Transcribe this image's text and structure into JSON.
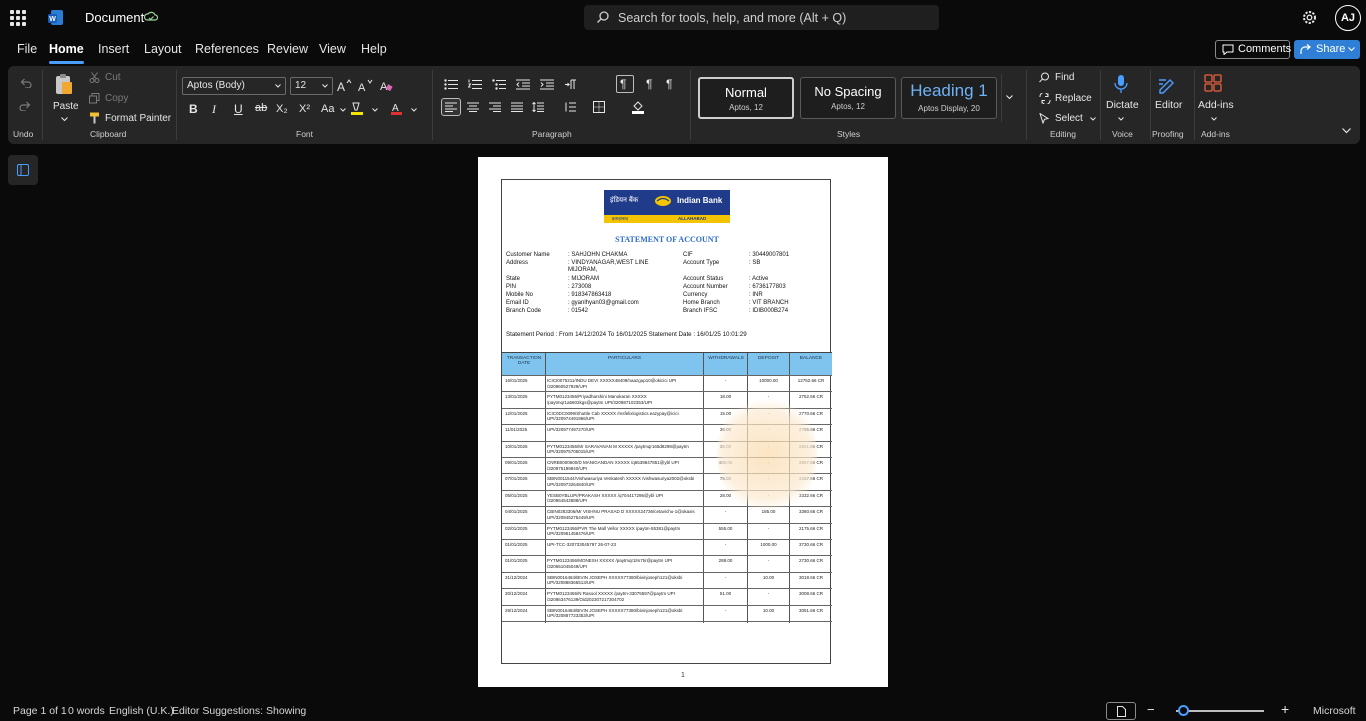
{
  "titlebar": {
    "doc_title": "Document",
    "search_placeholder": "Search for tools, help, and more (Alt + Q)",
    "avatar_initials": "AJ"
  },
  "menu": {
    "tabs": [
      "File",
      "Home",
      "Insert",
      "Layout",
      "References",
      "Review",
      "View",
      "Help"
    ],
    "active": "Home",
    "comments_label": "Comments",
    "share_label": "Share"
  },
  "ribbon": {
    "undo_label": "Undo",
    "clipboard": {
      "paste": "Paste",
      "cut": "Cut",
      "copy": "Copy",
      "format_painter": "Format Painter",
      "label": "Clipboard"
    },
    "font": {
      "family": "Aptos (Body)",
      "size": "12",
      "label": "Font"
    },
    "paragraph": {
      "label": "Paragraph"
    },
    "styles": {
      "items": [
        {
          "name": "Normal",
          "sub": "Aptos, 12"
        },
        {
          "name": "No Spacing",
          "sub": "Aptos, 12"
        },
        {
          "name": "Heading 1",
          "sub": "Aptos Display, 20"
        }
      ],
      "label": "Styles"
    },
    "editing": {
      "find": "Find",
      "replace": "Replace",
      "select": "Select",
      "label": "Editing"
    },
    "voice": {
      "dictate": "Dictate",
      "label": "Voice"
    },
    "proofing": {
      "editor": "Editor",
      "label": "Proofing"
    },
    "addins": {
      "addins": "Add-ins",
      "label": "Add-ins"
    }
  },
  "document": {
    "bank_hindi": "इंडियन बैंक",
    "bank_name": "Indian Bank",
    "bank_tag_hindi": "इलाहाबाद",
    "bank_tag": "ALLAHABAD",
    "title": "STATEMENT OF ACCOUNT",
    "left_fields": [
      {
        "k": "Customer Name",
        "v": ": SAHJOHN CHAKMA"
      },
      {
        "k": "Address",
        "v": ": VINDYANAGAR,WEST LINE"
      },
      {
        "k": "",
        "v": "MIJORAM,"
      },
      {
        "k": "State",
        "v": ": MIJORAM"
      },
      {
        "k": "PIN",
        "v": ": 273008"
      },
      {
        "k": "Mobile No",
        "v": ": 918347863418"
      },
      {
        "k": "Email ID",
        "v": ": gyanlhyan03@gmail.com"
      },
      {
        "k": "Branch Code",
        "v": ": 01542"
      }
    ],
    "right_fields": [
      {
        "k": "CIF",
        "v": ": 30449007801"
      },
      {
        "k": "Account Type",
        "v": ": SB"
      },
      {
        "k": "Account Status",
        "v": ": Active"
      },
      {
        "k": "Account Number",
        "v": ": 6736177803"
      },
      {
        "k": "Currency",
        "v": ": INR"
      },
      {
        "k": "Home Branch",
        "v": ": VIT BRANCH"
      },
      {
        "k": "Branch IFSC",
        "v": ": IDIB000B274"
      }
    ],
    "period": "Statement Period : From 14/12/2024 To 16/01/2025     Statement Date : 16/01/25  10:01:29",
    "headers": [
      "TRANSACTION DATE",
      "PARTICULARS",
      "WITHDRAWALS",
      "DEPOSIT",
      "BALANCE"
    ],
    "rows": [
      {
        "date": "16/01/2025",
        "part": "ICICI0075211/INDU DEVI XXXXX48408/naazgup10@okicici UPI /320960527929/UPI",
        "wd": "-",
        "dep": "10000.00",
        "bal": "12752.66 CR"
      },
      {
        "date": "13/01/2025",
        "part": "PYTM0123456/Priyadharshini Manokaran XXXXX /paytmqr1a5602kgs@paytm UPI/320987102353/UPI",
        "wd": "18.00",
        "dep": "-",
        "bal": "2752.66 CR"
      },
      {
        "date": "12/01/2025",
        "part": "ICIC0DC0099/Shuttle Cab XXXXX /msfelixlogistics.eazypay@icici UPI/320974491966/UPI",
        "wd": "15.00",
        "dep": "-",
        "bal": "2770.66 CR"
      },
      {
        "date": "11/01/2025",
        "part": "UPI/320977497270/UPI",
        "wd": "36.00",
        "dep": "-",
        "bal": "2785.66 CR"
      },
      {
        "date": "10/01/2025",
        "part": "PYTM0123456/Mr SARAVANAN M XXXXX /paytmqr165d8298@paytm UPI/320975705015/UPI",
        "wd": "36.00",
        "dep": "-",
        "bal": "2821.66 CR"
      },
      {
        "date": "09/01/2025",
        "part": "CNRB0000600/D MANIGANDAN XXXXX /q6539847851@ybl UPI /320975199840/UPI",
        "wd": "400.00",
        "dep": "-",
        "bal": "2857.66 CR"
      },
      {
        "date": "07/01/2025",
        "part": "SBIN0011544/Vishwasuriya Venkatesh XXXXX /vishwasuriya2002@oksbi UPI/320973264840/UPI",
        "wd": "75.00",
        "dep": "-",
        "bal": "3257.66 CR"
      },
      {
        "date": "05/01/2025",
        "part": "YESB0YBLUPI/PRAKASH XXXXX /q704417296@ybl UPI /320964542888/UPI",
        "wd": "28.00",
        "dep": "-",
        "bal": "3332.66 CR"
      },
      {
        "date": "04/01/2025",
        "part": "CBIN0283306/Mr VISHNU PRASAD D XXXXX24736/cetavichu-1@okaxis UPI/320845275449/UPI",
        "wd": "-",
        "dep": "185.00",
        "bal": "3360.66 CR"
      },
      {
        "date": "02/01/2025",
        "part": "PYTM0123456/PVR The Mall Vellor XXXXX /paytm-55381@paytm UPI/320961458476/UPI",
        "wd": "555.00",
        "dep": "-",
        "bal": "2175.66 CR"
      },
      {
        "date": "01/01/2025",
        "part": "UPI-TCC-320733045797 26-07-23",
        "wd": "-",
        "dep": "1000.00",
        "bal": "3730.66 CR"
      },
      {
        "date": "01/01/2025",
        "part": "PYTM0123456/MONESH XXXXX /paytmqr1lm7tir@paytm UPI /320651045049/UPI",
        "wd": "288.00",
        "dep": "-",
        "bal": "2730.66 CR"
      },
      {
        "date": "31/12/2024",
        "part": "SBIN0016484/BIVIN JOSEPH  XXXXX77380/bivinjoseph121@oksbi UPI/320888365513/UPI",
        "wd": "-",
        "dep": "10.00",
        "bal": "3018.66 CR"
      },
      {
        "date": "30/12/2024",
        "part": "PYTM0123456/N Rasool XXXXX /paytm-33075597@paytm UPI /320863476139/Oid202307217304702",
        "wd": "51.00",
        "dep": "-",
        "bal": "3008.66 CR"
      },
      {
        "date": "29/12/2024",
        "part": "SBIN0016484/BIVIN JOSEPH  XXXXX77380/bivinjoseph121@oksbi UPI/320887723353/UPI",
        "wd": "-",
        "dep": "10.00",
        "bal": "3051.66 CR"
      }
    ],
    "page_number": "1"
  },
  "status": {
    "page": "Page 1 of 1",
    "words": "0 words",
    "language": "English (U.K.)",
    "suggestions": "Editor Suggestions: Showing",
    "brand": "Microsoft"
  },
  "colors": {
    "accent": "#4a9eff",
    "share": "#2f7fd6",
    "bank_blue": "#1f3b8a",
    "bank_yellow": "#f5c400",
    "table_header": "#7fc4ef"
  }
}
